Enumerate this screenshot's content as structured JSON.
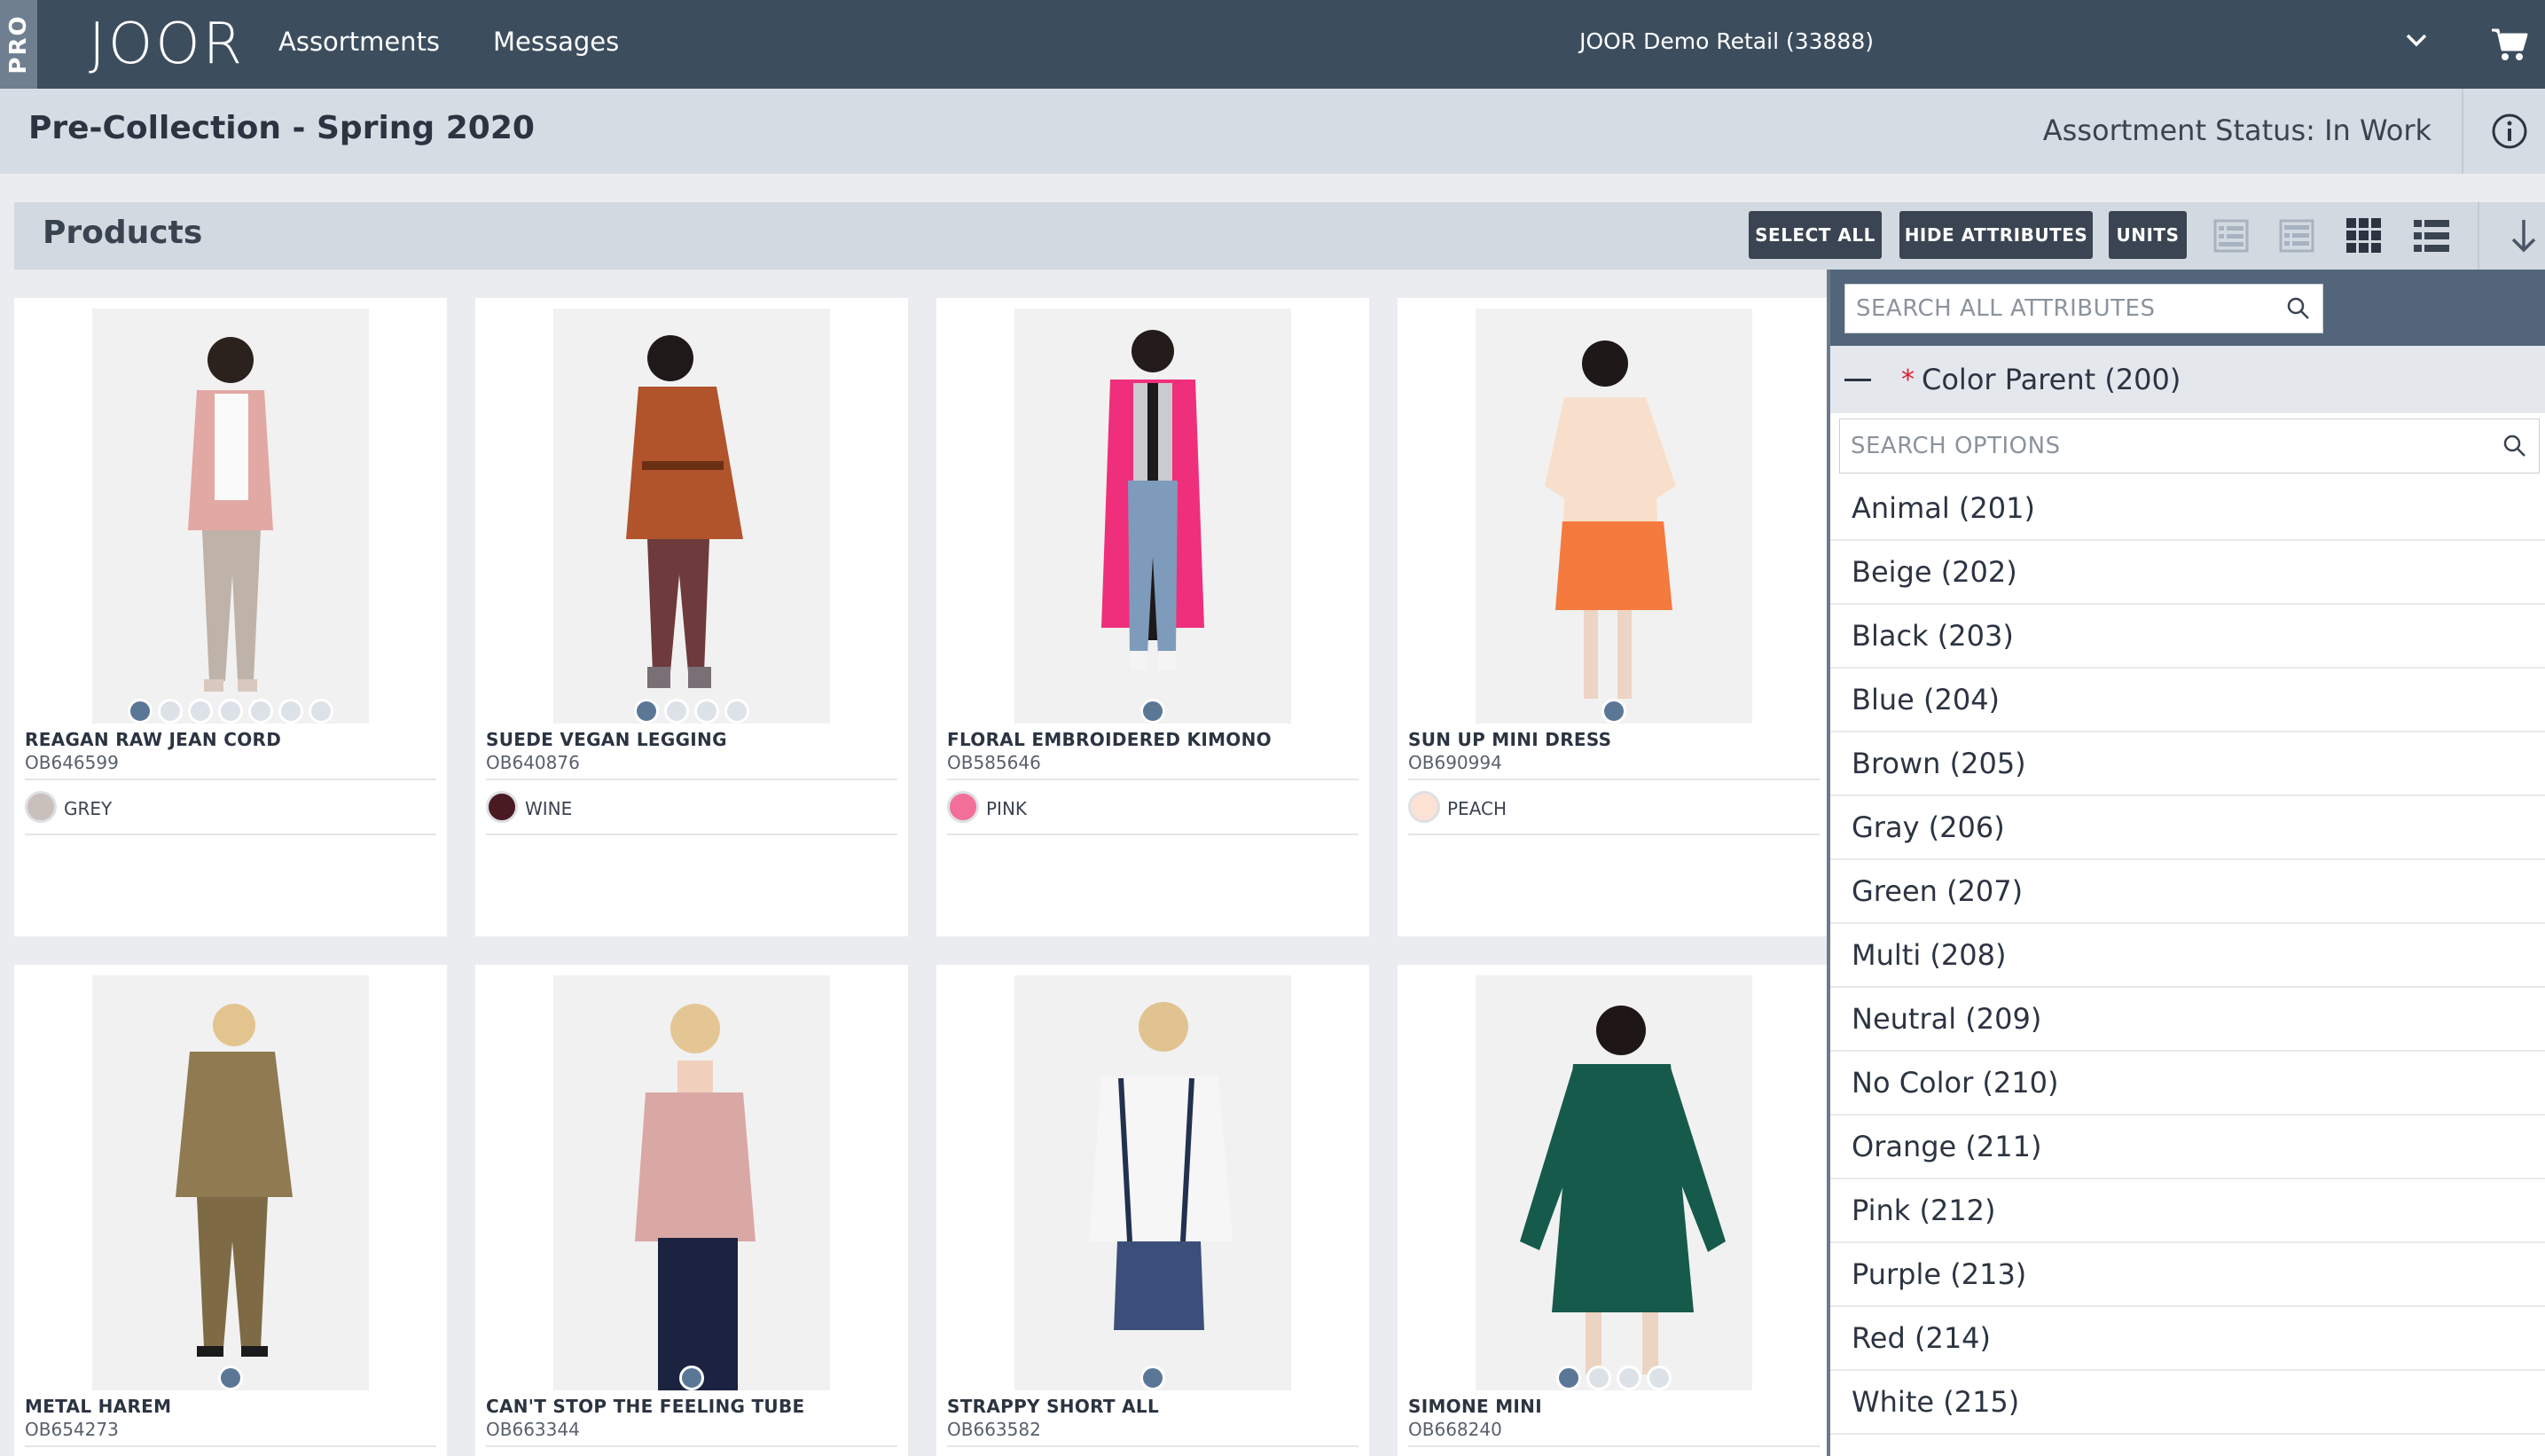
{
  "app": {
    "pro_badge": "PRO",
    "logo": "JOOR",
    "nav": [
      "Assortments",
      "Messages"
    ],
    "account": "JOOR Demo Retail (33888)"
  },
  "header": {
    "title": "Pre-Collection - Spring 2020",
    "status": "Assortment Status: In Work"
  },
  "toolbar": {
    "section_title": "Products",
    "select_all": "SELECT ALL",
    "hide_attributes": "HIDE ATTRIBUTES",
    "units": "UNITS"
  },
  "products": [
    {
      "name": "REAGAN RAW JEAN CORD",
      "sku": "OB646599",
      "color": "GREY",
      "swatch": "#c9bfbb",
      "dots": 7
    },
    {
      "name": "SUEDE VEGAN LEGGING",
      "sku": "OB640876",
      "color": "WINE",
      "swatch": "#4a1a22",
      "dots": 4
    },
    {
      "name": "FLORAL EMBROIDERED KIMONO",
      "sku": "OB585646",
      "color": "PINK",
      "swatch": "#f26f9a",
      "dots": 1
    },
    {
      "name": "SUN UP MINI DRESS",
      "sku": "OB690994",
      "color": "PEACH",
      "swatch": "#fbe2d2",
      "dots": 1
    },
    {
      "name": "METAL HAREM",
      "sku": "OB654273",
      "dots": 1
    },
    {
      "name": "CAN'T STOP THE FEELING TUBE",
      "sku": "OB663344",
      "dots": 1
    },
    {
      "name": "STRAPPY SHORT ALL",
      "sku": "OB663582",
      "dots": 1
    },
    {
      "name": "SIMONE MINI",
      "sku": "OB668240",
      "dots": 4
    }
  ],
  "filter": {
    "search_placeholder": "SEARCH ALL ATTRIBUTES",
    "parent_label": "Color Parent (200)",
    "required_mark": "*",
    "options_placeholder": "SEARCH OPTIONS",
    "options": [
      "Animal (201)",
      "Beige (202)",
      "Black (203)",
      "Blue (204)",
      "Brown (205)",
      "Gray (206)",
      "Green (207)",
      "Multi (208)",
      "Neutral (209)",
      "No Color (210)",
      "Orange (211)",
      "Pink (212)",
      "Purple (213)",
      "Red (214)",
      "White (215)"
    ]
  }
}
